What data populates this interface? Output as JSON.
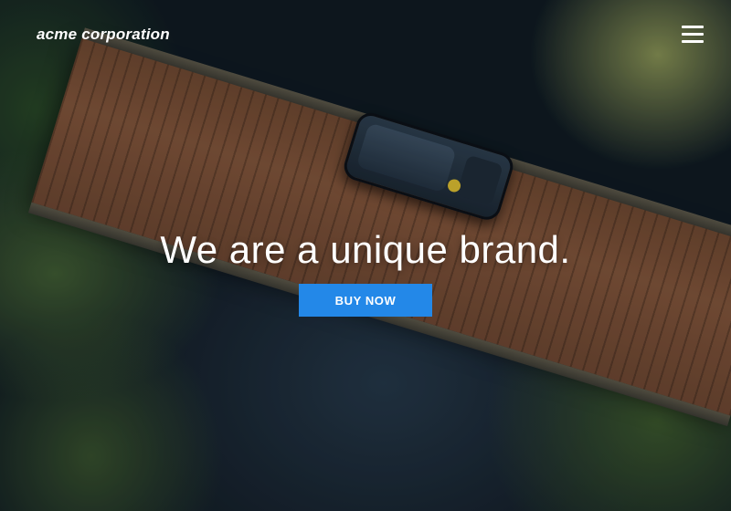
{
  "header": {
    "logo_text": "acme corporation",
    "menu_icon": "hamburger-menu-icon"
  },
  "hero": {
    "headline": "We are a unique brand.",
    "cta_label": "BUY NOW",
    "cta_color": "#2388e8"
  }
}
